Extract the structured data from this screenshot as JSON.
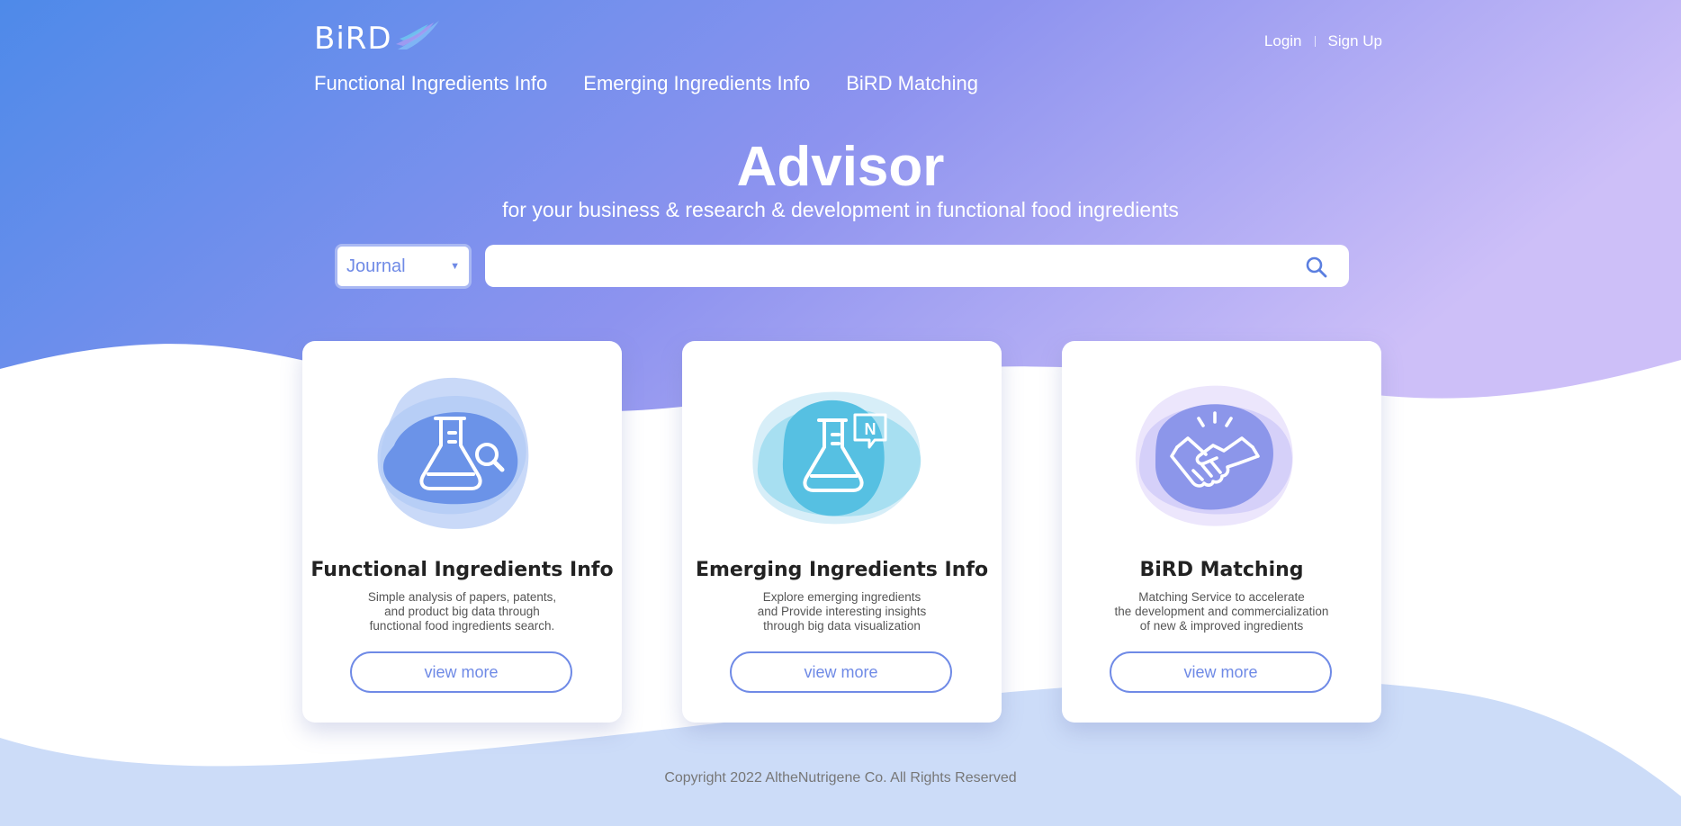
{
  "header": {
    "logo_text": "BiRD",
    "login": "Login",
    "signup": "Sign Up",
    "nav": [
      "Functional Ingredients Info",
      "Emerging Ingredients Info",
      "BiRD Matching"
    ]
  },
  "hero": {
    "title": "Advisor",
    "subtitle": "for your business & research & development in functional food ingredients"
  },
  "search": {
    "category_selected": "Journal",
    "query": ""
  },
  "cards": [
    {
      "title": "Functional Ingredients Info",
      "desc": [
        "Simple analysis of papers, patents,",
        "and product big data through",
        "functional food ingredients search."
      ],
      "button": "view more",
      "icon": "flask-search-icon"
    },
    {
      "title": "Emerging Ingredients Info",
      "desc": [
        "Explore emerging ingredients",
        "and Provide interesting insights",
        "through big data visualization"
      ],
      "button": "view more",
      "icon": "flask-news-icon"
    },
    {
      "title": "BiRD Matching",
      "desc": [
        "Matching Service to accelerate",
        "the development and commercialization",
        "of new & improved ingredients"
      ],
      "button": "view more",
      "icon": "handshake-icon"
    }
  ],
  "footer": {
    "copyright": "Copyright 2022 AltheNutrigene Co. All Rights Reserved"
  },
  "colors": {
    "hero_gradient_start": "#4e8ae9",
    "hero_gradient_end": "#c9bdf7",
    "accent": "#6f8ae6",
    "footer_wave": "#ccdcf8"
  }
}
